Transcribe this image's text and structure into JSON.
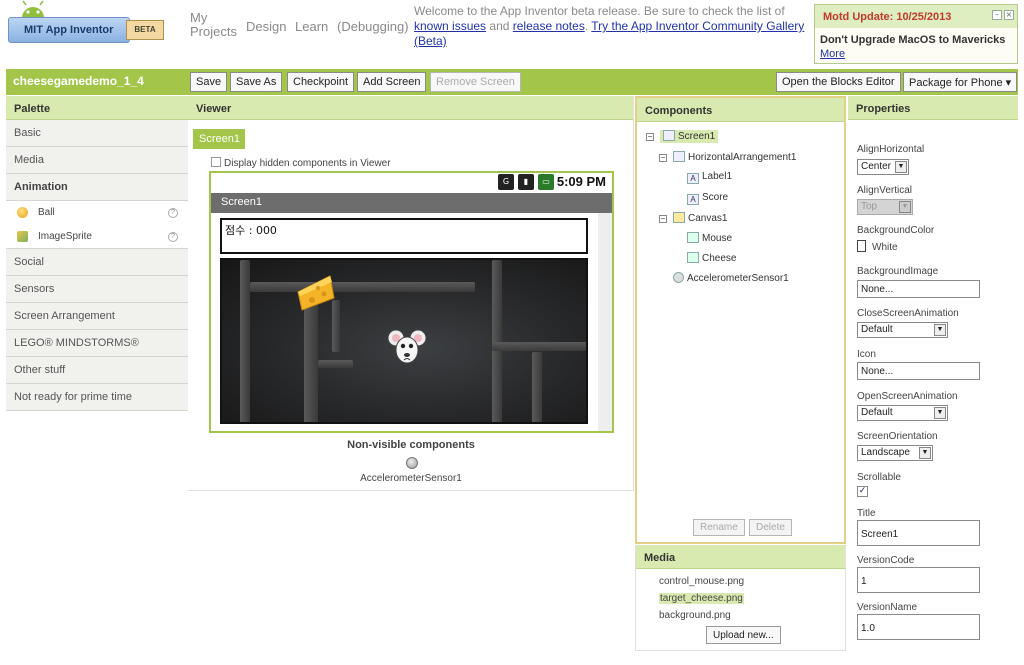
{
  "header": {
    "logo_text": "MIT App Inventor",
    "beta_label": "BETA",
    "nav": [
      "My\nProjects",
      "Design",
      "Learn",
      "(Debugging)"
    ],
    "welcome_text": "Welcome to the App Inventor beta release. Be sure to check the list of",
    "link_known_issues": "known issues",
    "and_text": "and",
    "link_release_notes": "release notes",
    "link_gallery": "Try the App Inventor Community Gallery (Beta)"
  },
  "motd": {
    "title": "Motd Update: 10/25/2013",
    "body": "Don't Upgrade MacOS to Mavericks",
    "more_link": "More"
  },
  "toolbar": {
    "project_name": "cheesegamedemo_1_4",
    "save": "Save",
    "save_as": "Save As",
    "checkpoint": "Checkpoint",
    "add_screen": "Add Screen",
    "remove_screen": "Remove Screen",
    "open_blocks": "Open the Blocks Editor",
    "package_phone": "Package for Phone ▾"
  },
  "palette": {
    "title": "Palette",
    "basic": "Basic",
    "media": "Media",
    "animation": "Animation",
    "ball": "Ball",
    "image_sprite": "ImageSprite",
    "social": "Social",
    "sensors": "Sensors",
    "screen_arrangement": "Screen Arrangement",
    "lego": "LEGO® MINDSTORMS®",
    "other": "Other stuff",
    "not_ready": "Not ready for prime time",
    "help_glyph": "?"
  },
  "viewer": {
    "title": "Viewer",
    "screen_tab": "Screen1",
    "display_hidden": "Display hidden components in Viewer",
    "time": "5:09 PM",
    "screen_title": "Screen1",
    "label_text": "점수 :   000",
    "nonvisible_title": "Non-visible components",
    "nonvisible_item": "AccelerometerSensor1"
  },
  "components": {
    "title": "Components",
    "tree": {
      "screen1": "Screen1",
      "horizontal": "HorizontalArrangement1",
      "label1": "Label1",
      "score": "Score",
      "canvas1": "Canvas1",
      "mouse": "Mouse",
      "cheese": "Cheese",
      "accelerometer": "AccelerometerSensor1"
    },
    "rename": "Rename",
    "delete": "Delete"
  },
  "media": {
    "title": "Media",
    "files": [
      "control_mouse.png",
      "target_cheese.png",
      "background.png"
    ],
    "upload": "Upload new..."
  },
  "properties": {
    "title": "Properties",
    "align_h_label": "AlignHorizontal",
    "align_h_value": "Center",
    "align_v_label": "AlignVertical",
    "align_v_value": "Top",
    "bg_color_label": "BackgroundColor",
    "bg_color_value": "White",
    "bg_image_label": "BackgroundImage",
    "bg_image_value": "None...",
    "close_anim_label": "CloseScreenAnimation",
    "close_anim_value": "Default",
    "icon_label": "Icon",
    "icon_value": "None...",
    "open_anim_label": "OpenScreenAnimation",
    "open_anim_value": "Default",
    "orientation_label": "ScreenOrientation",
    "orientation_value": "Landscape",
    "scrollable_label": "Scrollable",
    "title_label": "Title",
    "title_value": "Screen1",
    "version_code_label": "VersionCode",
    "version_code_value": "1",
    "version_name_label": "VersionName",
    "version_name_value": "1.0"
  },
  "colors": {
    "accent_green": "#a3c54a",
    "panel_header": "#d9eab0",
    "motd_title": "#c0392b",
    "link_blue": "#2233aa"
  }
}
